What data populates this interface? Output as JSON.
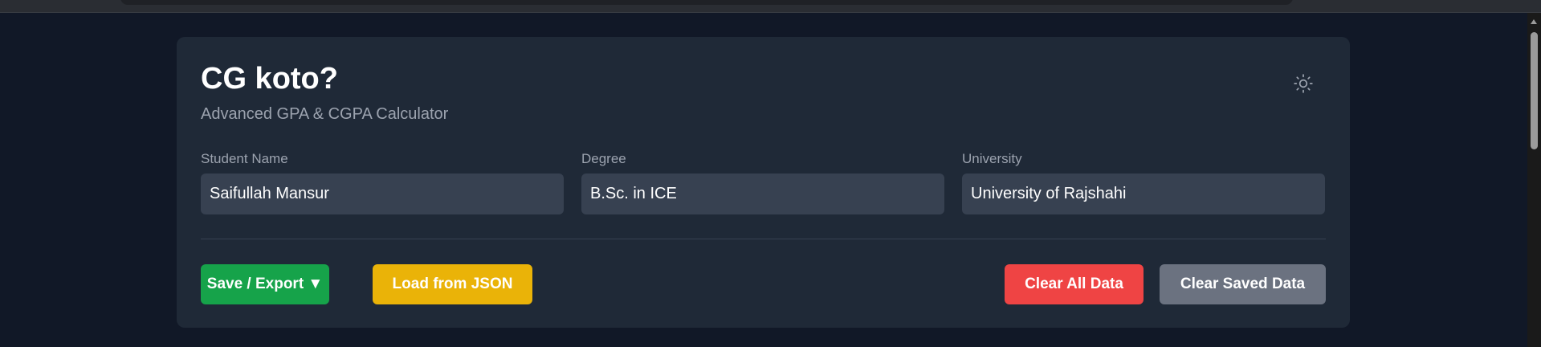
{
  "app": {
    "title": "CG koto?",
    "subtitle": "Advanced GPA & CGPA Calculator"
  },
  "fields": {
    "student_name": {
      "label": "Student Name",
      "value": "Saifullah Mansur"
    },
    "degree": {
      "label": "Degree",
      "value": "B.Sc. in ICE"
    },
    "university": {
      "label": "University",
      "value": "University of Rajshahi"
    }
  },
  "actions": {
    "save_export_label": "Save / Export ▼",
    "load_json_label": "Load from JSON",
    "clear_all_label": "Clear All Data",
    "clear_saved_label": "Clear Saved Data"
  },
  "icons": {
    "theme_toggle": "sun-icon"
  },
  "colors": {
    "page_bg": "#111827",
    "card_bg": "#1f2937",
    "input_bg": "#374151",
    "save_green": "#16a34a",
    "load_yellow": "#eab308",
    "clear_red": "#ef4444",
    "clear_gray": "#6b7280"
  }
}
